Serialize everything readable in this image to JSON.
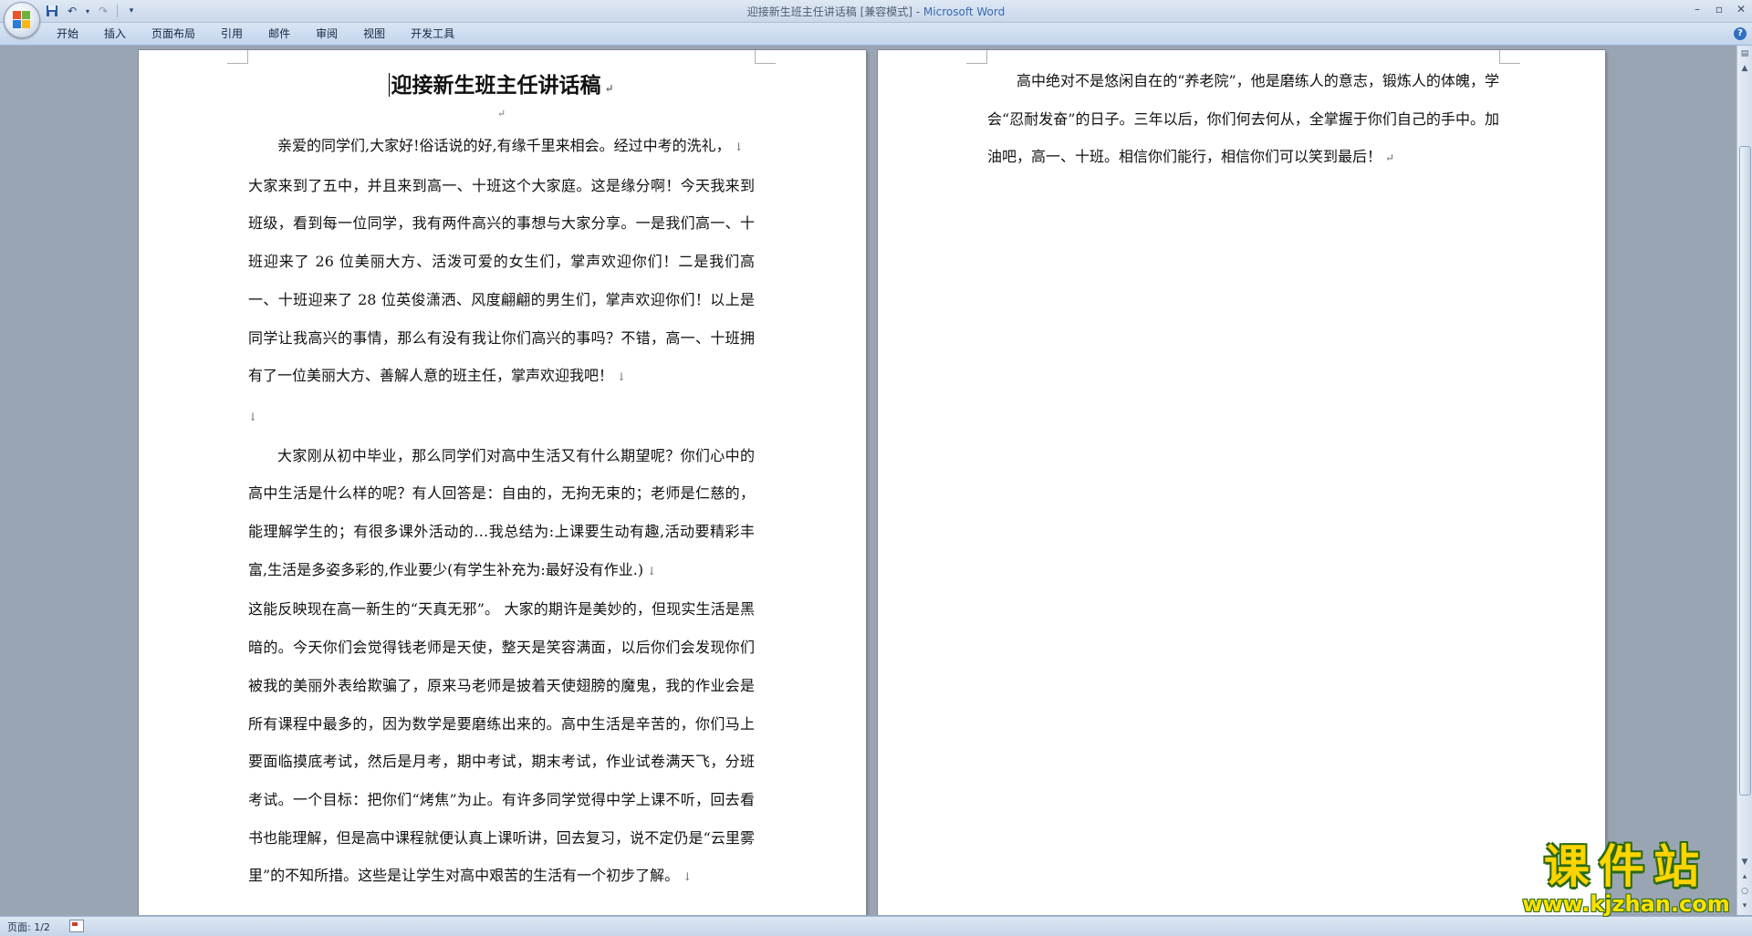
{
  "window": {
    "title_doc": "迎接新生班主任讲话稿 [兼容模式] - ",
    "title_app": "Microsoft Word"
  },
  "quick_access": {
    "save_icon": "save-icon",
    "undo_icon": "undo-icon",
    "redo_icon": "redo-icon",
    "customize_icon": "dropdown-icon"
  },
  "ribbon": {
    "tabs": [
      "开始",
      "插入",
      "页面布局",
      "引用",
      "邮件",
      "审阅",
      "视图",
      "开发工具"
    ]
  },
  "document": {
    "title": "迎接新生班主任讲话稿",
    "para_mark": "↵",
    "line_break_mark": "↓",
    "paragraphs": [
      "亲爱的同学们,大家好!俗话说的好,有缘千里来相会。经过中考的洗礼，",
      "大家来到了五中，并且来到高一、十班这个大家庭。这是缘分啊！今天我来到班级，看到每一位同学，我有两件高兴的事想与大家分享。一是我们高一、十班迎来了 26 位美丽大方、活泼可爱的女生们，掌声欢迎你们！二是我们高一、十班迎来了 28 位英俊潇洒、风度翩翩的男生们，掌声欢迎你们！以上是同学让我高兴的事情，那么有没有我让你们高兴的事吗？不错，高一、十班拥有了一位美丽大方、善解人意的班主任，掌声欢迎我吧！",
      "大家刚从初中毕业，那么同学们对高中生活又有什么期望呢？你们心中的高中生活是什么样的呢？有人回答是：自由的，无拘无束的；老师是仁慈的，能理解学生的；有很多课外活动的…我总结为:上课要生动有趣,活动要精彩丰富,生活是多姿多彩的,作业要少(有学生补充为:最好没有作业.)",
      "这能反映现在高一新生的“天真无邪”。 大家的期许是美妙的，但现实生活是黑暗的。今天你们会觉得钱老师是天使，整天是笑容满面，以后你们会发现你们被我的美丽外表给欺骗了，原来马老师是披着天使翅膀的魔鬼，我的作业会是所有课程中最多的，因为数学是要磨练出来的。高中生活是辛苦的，你们马上要面临摸底考试，然后是月考，期中考试，期末考试，作业试卷满天飞，分班考试。一个目标：把你们“烤焦”为止。有许多同学觉得中学上课不听，回去看书也能理解，但是高中课程就便认真上课听讲，回去复习，说不定仍是“云里雾里”的不知所措。这些是让学生对高中艰苦的生活有一个初步了解。",
      "高中绝对不是悠闲自在的“养老院”，他是磨练人的意志，锻炼人的体魄，学会“忍耐发奋”的日子。三年以后，你们何去何从，全掌握于你们自己的手中。加油吧，高一、十班。相信你们能行，相信你们可以笑到最后！"
    ]
  },
  "statusbar": {
    "page": "页面: 1/2"
  },
  "watermark": {
    "logo": "课件站",
    "url": "www.kjzhan.com"
  }
}
